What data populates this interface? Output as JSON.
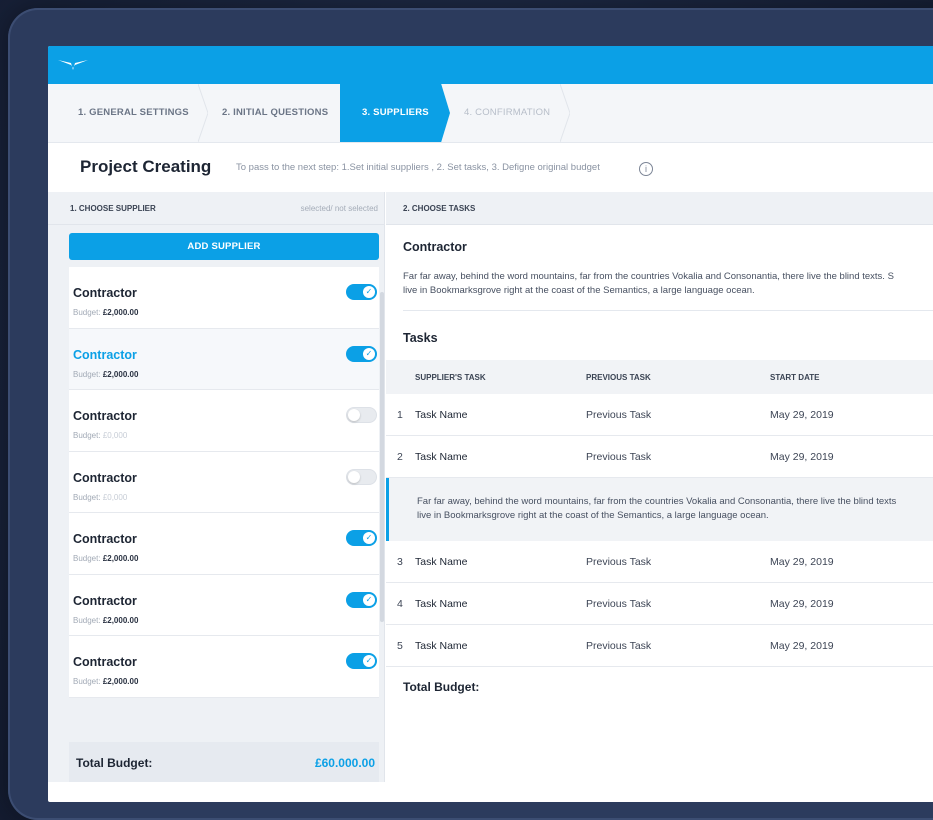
{
  "colors": {
    "accent": "#0ba0e6",
    "dark_text": "#1d2533"
  },
  "steps": [
    {
      "label": "1. GENERAL SETTINGS",
      "state": "done"
    },
    {
      "label": "2. INITIAL QUESTIONS",
      "state": "done"
    },
    {
      "label": "3. SUPPLIERS",
      "state": "active"
    },
    {
      "label": "4. CONFIRMATION",
      "state": "disabled"
    }
  ],
  "header": {
    "title": "Project Creating",
    "hint": "To pass to the next step: 1.Set initial suppliers , 2. Set tasks, 3. Defigne original budget",
    "info_icon": "i"
  },
  "suppliers_panel": {
    "title": "1. CHOOSE SUPPLIER",
    "subtitle": "selected/ not selected",
    "add_button": "ADD SUPPLIER",
    "budget_label": "Budget:",
    "items": [
      {
        "name": "Contractor",
        "budget": "£2,000.00",
        "selected": true,
        "active": false
      },
      {
        "name": "Contractor",
        "budget": "£2,000.00",
        "selected": true,
        "active": true
      },
      {
        "name": "Contractor",
        "budget": "£0,000",
        "selected": false,
        "active": false
      },
      {
        "name": "Contractor",
        "budget": "£0,000",
        "selected": false,
        "active": false
      },
      {
        "name": "Contractor",
        "budget": "£2,000.00",
        "selected": true,
        "active": false
      },
      {
        "name": "Contractor",
        "budget": "£2,000.00",
        "selected": true,
        "active": false
      },
      {
        "name": "Contractor",
        "budget": "£2,000.00",
        "selected": true,
        "active": false
      }
    ],
    "total_label": "Total Budget:",
    "total_value": "£60.000.00"
  },
  "tasks_panel": {
    "title": "2. CHOOSE TASKS",
    "contractor_title": "Contractor",
    "contractor_text_line1": "Far far away, behind the word mountains, far from the countries Vokalia and Consonantia, there live the blind texts. S",
    "contractor_text_line2": "live in Bookmarksgrove right at the coast of the Semantics, a large language ocean.",
    "tasks_title": "Tasks",
    "columns": [
      "SUPPLIER'S TASK",
      "PREVIOUS TASK",
      "START DATE"
    ],
    "rows": [
      {
        "num": "1",
        "name": "Task Name",
        "prev": "Previous Task",
        "date": "May 29, 2019"
      },
      {
        "num": "2",
        "name": "Task Name",
        "prev": "Previous Task",
        "date": "May 29, 2019"
      },
      {
        "num": "3",
        "name": "Task Name",
        "prev": "Previous Task",
        "date": "May 29, 2019"
      },
      {
        "num": "4",
        "name": "Task Name",
        "prev": "Previous Task",
        "date": "May 29, 2019"
      },
      {
        "num": "5",
        "name": "Task Name",
        "prev": "Previous Task",
        "date": "May 29, 2019"
      }
    ],
    "row_detail_line1": "Far far away, behind the word mountains, far from the countries Vokalia and Consonantia, there live the blind texts",
    "row_detail_line2": "live in Bookmarksgrove right at the coast of the Semantics, a large language ocean.",
    "total_label": "Total Budget:"
  }
}
